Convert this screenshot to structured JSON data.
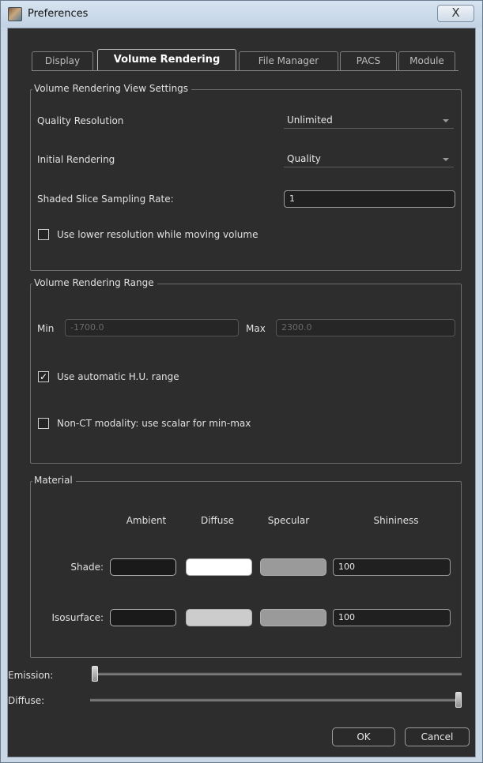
{
  "window": {
    "title": "Preferences",
    "close_glyph": "X"
  },
  "tabs": [
    {
      "label": "Display",
      "active": false
    },
    {
      "label": "Volume Rendering",
      "active": true
    },
    {
      "label": "File Manager",
      "active": false
    },
    {
      "label": "PACS",
      "active": false
    },
    {
      "label": "Module",
      "active": false
    }
  ],
  "view_settings": {
    "title": "Volume Rendering View Settings",
    "quality_resolution_label": "Quality Resolution",
    "quality_resolution_value": "Unlimited",
    "initial_rendering_label": "Initial Rendering",
    "initial_rendering_value": "Quality",
    "sampling_rate_label": "Shaded Slice Sampling Rate:",
    "sampling_rate_value": "1",
    "lower_res_label": "Use lower resolution while moving volume",
    "lower_res_checked": false
  },
  "range": {
    "title": "Volume Rendering Range",
    "min_label": "Min",
    "min_value": "-1700.0",
    "max_label": "Max",
    "max_value": "2300.0",
    "auto_hu_label": "Use automatic H.U. range",
    "auto_hu_checked": true,
    "auto_hu_mark": "✓",
    "non_ct_label": "Non-CT modality: use scalar for min-max",
    "non_ct_checked": false
  },
  "material": {
    "title": "Material",
    "headers": {
      "ambient": "Ambient",
      "diffuse": "Diffuse",
      "specular": "Specular",
      "shininess": "Shininess"
    },
    "shade": {
      "label": "Shade:",
      "ambient_color": "#1a1a1a",
      "diffuse_color": "#ffffff",
      "specular_color": "#9a9a9a",
      "shininess": "100"
    },
    "isosurface": {
      "label": "Isosurface:",
      "ambient_color": "#1a1a1a",
      "diffuse_color": "#cccccc",
      "specular_color": "#9a9a9a",
      "shininess": "100"
    }
  },
  "sliders": {
    "emission_label": "Emission:",
    "emission_value": 0.0,
    "diffuse_label": "Diffuse:",
    "diffuse_value": 1.0
  },
  "buttons": {
    "ok": "OK",
    "cancel": "Cancel"
  }
}
